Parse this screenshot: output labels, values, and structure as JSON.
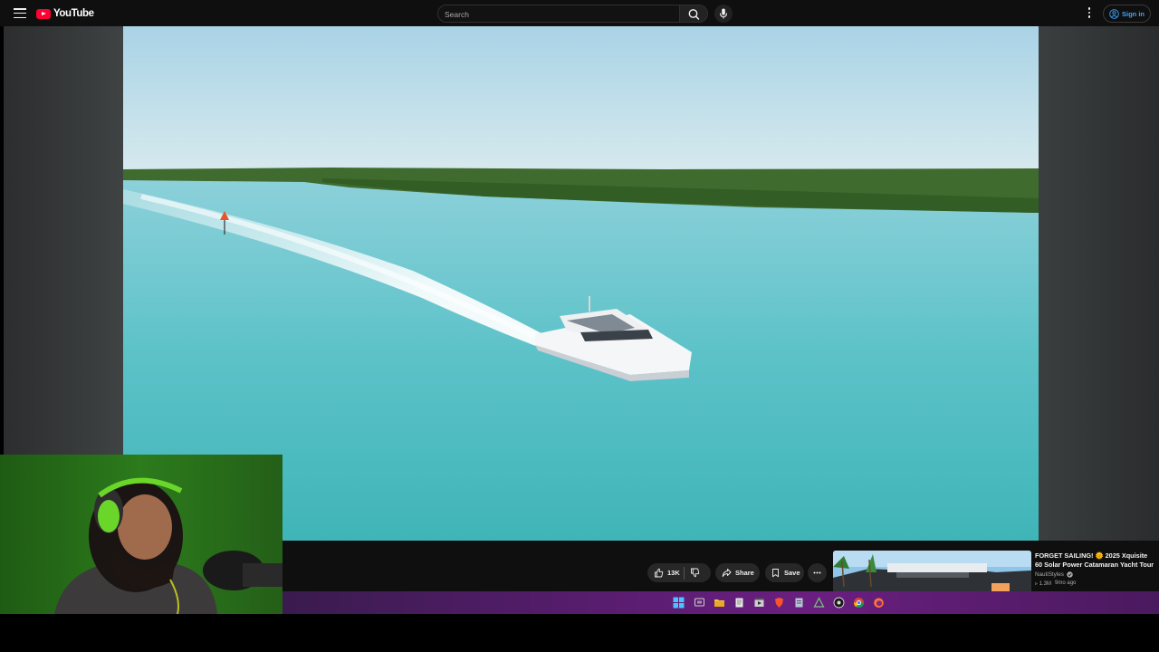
{
  "app": {
    "brand": "YouTube",
    "brand_color": "#ff0033"
  },
  "header": {
    "search_placeholder": "Search",
    "signin_label": "Sign in",
    "icons": [
      "menu-icon",
      "search-icon",
      "mic-icon",
      "more-vert-icon",
      "account-icon"
    ]
  },
  "actions": {
    "like_count": "13K",
    "share_label": "Share",
    "save_label": "Save"
  },
  "recommended": {
    "title": "FORGET SAILING! 🌞 2025 Xquisite 60 Solar Power Catamaran Yacht Tour",
    "channel": "NautiStyles",
    "views": "1.3M",
    "age": "9mo ago"
  },
  "colors": {
    "accent_link": "#3ea6ff",
    "background": "#0f0f0f",
    "taskbar": "#5b1d72"
  }
}
